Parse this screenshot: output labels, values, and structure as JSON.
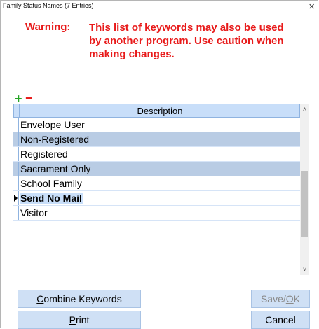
{
  "window": {
    "title": "Family Status Names (7 Entries)",
    "close_glyph": "×"
  },
  "warning": {
    "label": "Warning:",
    "message": "This list of keywords may also be used by another program. Use caution when making changes."
  },
  "toolbar": {
    "add_glyph": "+",
    "remove_glyph": "−"
  },
  "grid": {
    "column_header": "Description",
    "rows": [
      {
        "label": "Envelope User"
      },
      {
        "label": "Non-Registered"
      },
      {
        "label": "Registered"
      },
      {
        "label": "Sacrament Only"
      },
      {
        "label": "School Family"
      },
      {
        "label": "Send No Mail"
      },
      {
        "label": "Visitor"
      }
    ],
    "current_row": "Send No Mail"
  },
  "scrollbar": {
    "up_glyph": "˄",
    "down_glyph": "˅"
  },
  "buttons": {
    "combine_prefix": "C",
    "combine_rest": "ombine Keywords",
    "print_prefix": "P",
    "print_rest": "rint",
    "save_before": "Save/",
    "save_underlined": "O",
    "save_after": "K",
    "cancel_label": "Cancel"
  },
  "colors": {
    "warning": "#e81a1a",
    "add": "#25a525",
    "header_bg": "#c8def9",
    "alt_row_bg": "#b9cce4",
    "button_bg": "#cfe0f5"
  }
}
